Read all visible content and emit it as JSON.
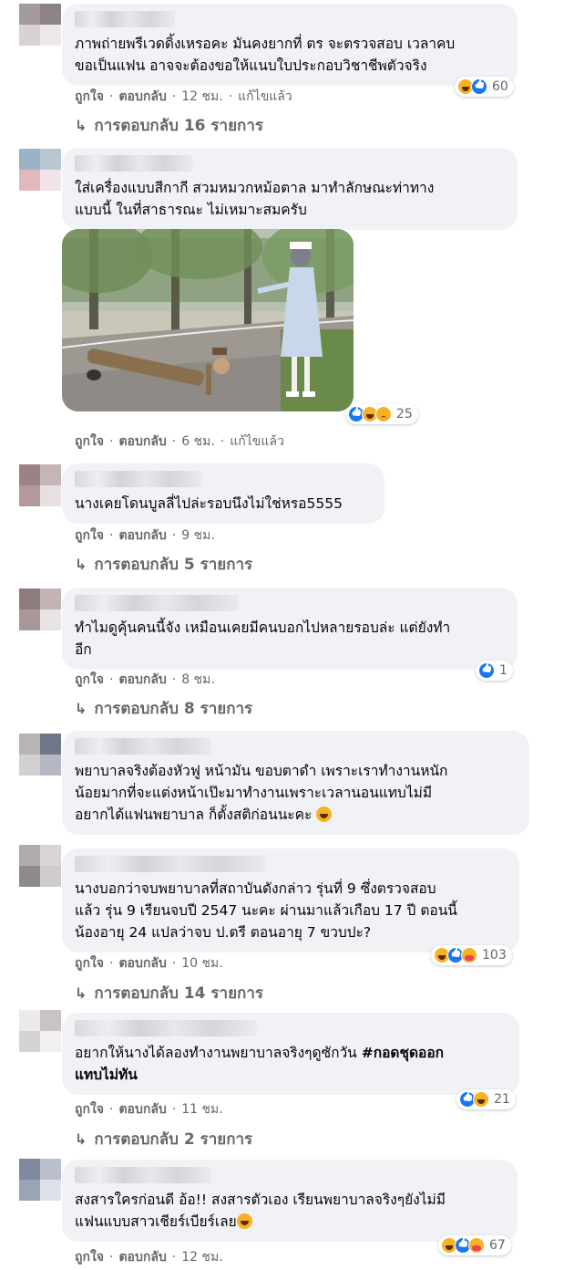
{
  "labels": {
    "like": "ถูกใจ",
    "reply": "ตอบกลับ",
    "edited": "แก้ไขแล้ว",
    "dot": "·"
  },
  "comments": [
    {
      "text": "ภาพถ่ายพรีเวดดิ้งเหรอคะ มันคงยากที่ ตร จะตรวจสอบ เวลาคบ\nขอเป็นแฟน อาจจะต้องขอให้แนบใบประกอบวิชาชีพตัวจริง",
      "time": "12 ชม.",
      "edited": true,
      "reactions": [
        "haha",
        "like"
      ],
      "reaction_count": "60",
      "replies": "การตอบกลับ 16 รายการ"
    },
    {
      "text": "ใส่เครื่องแบบสีกากี สวมหมวกหม้อตาล มาทำลักษณะท่าทาง\nแบบนี้ ในที่สาธารณะ ไม่เหมาะสมครับ",
      "time": "6 ชม.",
      "edited": true,
      "reactions": [
        "like",
        "haha",
        "sad"
      ],
      "reaction_count": "25",
      "has_photo": true
    },
    {
      "text": "นางเคยโดนบูลลี่ไปล่ะรอบนึงไม่ใช่หรอ5555",
      "time": "9 ชม.",
      "replies": "การตอบกลับ 5 รายการ"
    },
    {
      "text": "ทำไมดูคุ้นคนนี้จัง เหมือนเคยมีคนบอกไปหลายรอบล่ะ แต่ยังทำ\nอีก",
      "time": "8 ชม.",
      "reactions": [
        "like"
      ],
      "reaction_count": "1",
      "replies": "การตอบกลับ 8 รายการ"
    },
    {
      "text": "พยาบาลจริงต้องหัวฟู หน้ามัน ขอบตาดำ เพราะเราทำงานหนัก\nน้อยมากที่จะแต่งหน้าเป๊ะมาทำงานเพราะเวลานอนแทบไม่มี\nอยากได้แฟนพยาบาล ก็ตั้งสติก่อนนะคะ"
    },
    {
      "text": "นางบอกว่าจบพยาบาลที่สถาบันดังกล่าว รุ่นที่ 9 ซึ่งตรวจสอบ\nแล้ว รุ่น 9 เรียนจบปี 2547 นะคะ ผ่านมาแล้วเกือบ 17 ปี ตอนนี้\nน้องอายุ 24 แปลว่าจบ ป.ตรี ตอนอายุ 7 ขวบปะ?",
      "time": "10 ชม.",
      "reactions": [
        "haha",
        "like",
        "care"
      ],
      "reaction_count": "103",
      "replies": "การตอบกลับ 14 รายการ"
    },
    {
      "text": "อยากให้นางได้ลองทำงานพยาบาลจริงๆดูซักวัน ",
      "hashtag": "#กอดชุดออก\nแทบไม่ทัน",
      "time": "11 ชม.",
      "reactions": [
        "like",
        "haha"
      ],
      "reaction_count": "21",
      "replies": "การตอบกลับ 2 รายการ"
    },
    {
      "text": "สงสารใครก่อนดี อ้อ!! สงสารตัวเอง เรียนพยาบาลจริงๆยังไม่มี\nแฟนแบบสาวเชียร์เบียร์เลย",
      "time": "12 ชม.",
      "reactions": [
        "haha",
        "like",
        "care"
      ],
      "reaction_count": "67"
    }
  ]
}
